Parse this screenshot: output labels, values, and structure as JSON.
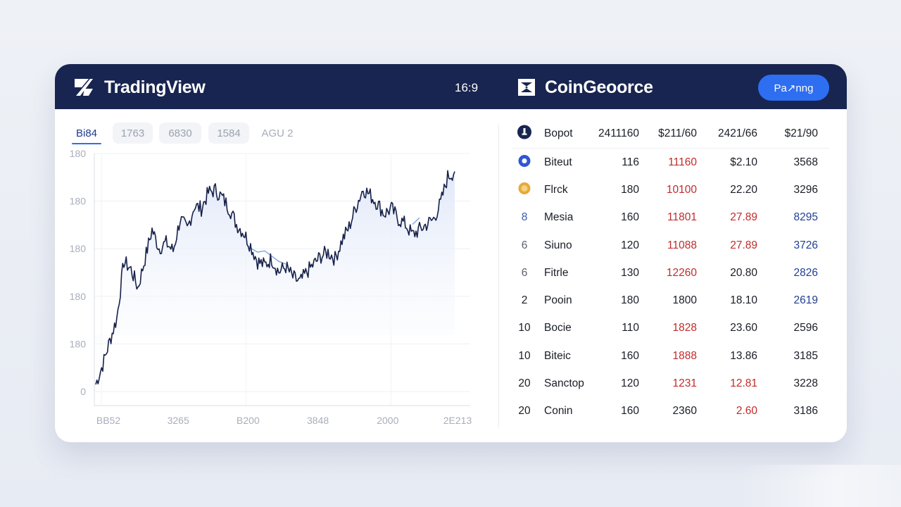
{
  "header": {
    "left_brand": "TradingView",
    "ratio_label": "16:9",
    "right_brand": "CoinGeoorce",
    "cta_label": "Pa↗nng"
  },
  "colors": {
    "navy": "#182550",
    "accent": "#2e6ef0",
    "line": "#16214a",
    "down_red": "#c02b2b",
    "up_blue": "#213e95"
  },
  "icons": {
    "tv_logo": "tradingview-logo-icon",
    "cg_logo": "coin-logo-icon",
    "header_row": "coin-navy-icon",
    "row_1": "coin-blue-icon",
    "row_2": "coin-gold-icon"
  },
  "tabs": [
    {
      "label": "Bi84"
    },
    {
      "label": "1763"
    },
    {
      "label": "6830"
    },
    {
      "label": "1584"
    },
    {
      "label": "AGU 2"
    }
  ],
  "chart_data": {
    "type": "line",
    "y_ticks": [
      "180",
      "180",
      "180",
      "180",
      "180",
      "0"
    ],
    "x_ticks": [
      "BB52",
      "3265",
      "B200",
      "3848",
      "2000",
      "2E213"
    ],
    "ylim": [
      0,
      180
    ],
    "grid": true,
    "legend": "none",
    "x": [
      0,
      10,
      20,
      30,
      40,
      50,
      60,
      70,
      80,
      90,
      100,
      110,
      120,
      130,
      140,
      150,
      160,
      170,
      180,
      190,
      200,
      210,
      220,
      230,
      240,
      250,
      260,
      270,
      280,
      290,
      300,
      310,
      320,
      330,
      340,
      350,
      360,
      370,
      380,
      390,
      400,
      410,
      420,
      430,
      440,
      450,
      460,
      470,
      480,
      490,
      500,
      510
    ],
    "values": [
      15,
      30,
      48,
      65,
      108,
      102,
      88,
      110,
      132,
      118,
      122,
      116,
      140,
      132,
      150,
      148,
      160,
      162,
      156,
      148,
      136,
      130,
      120,
      108,
      105,
      110,
      100,
      104,
      96,
      92,
      100,
      106,
      112,
      115,
      110,
      124,
      134,
      150,
      163,
      158,
      152,
      144,
      148,
      140,
      136,
      128,
      132,
      136,
      140,
      152,
      172,
      176
    ],
    "overlay_values": [
      null,
      null,
      null,
      null,
      null,
      null,
      null,
      null,
      null,
      null,
      null,
      null,
      null,
      null,
      null,
      null,
      null,
      null,
      null,
      null,
      null,
      null,
      118,
      115,
      116,
      112,
      108,
      106,
      null,
      null,
      null,
      null,
      null,
      null,
      null,
      null,
      null,
      null,
      null,
      null,
      null,
      null,
      null,
      null,
      null,
      136,
      141,
      null,
      null,
      null,
      null,
      null
    ]
  },
  "table": {
    "header": {
      "name": "Bopot",
      "a": "2411160",
      "b": "$211/60",
      "c": "2421/66",
      "d": "$21/90"
    },
    "rows": [
      {
        "rank": "",
        "name": "Biteut",
        "a": "116",
        "b": "11160",
        "c": "$2.10",
        "d": "3568",
        "b_color": "red",
        "c_color": "",
        "d_color": ""
      },
      {
        "rank": "",
        "name": "Flrck",
        "a": "180",
        "b": "10100",
        "c": "22.20",
        "d": "3296",
        "b_color": "red",
        "c_color": "",
        "d_color": ""
      },
      {
        "rank": "8",
        "name": "Mesia",
        "a": "160",
        "b": "11801",
        "c": "27.89",
        "d": "8295",
        "b_color": "red",
        "c_color": "red",
        "d_color": "blue",
        "rank_color": "blue"
      },
      {
        "rank": "6",
        "name": "Siuno",
        "a": "120",
        "b": "11088",
        "c": "27.89",
        "d": "3726",
        "b_color": "red",
        "c_color": "red",
        "d_color": "blue",
        "rank_color": "gray"
      },
      {
        "rank": "6",
        "name": "Fitrle",
        "a": "130",
        "b": "12260",
        "c": "20.80",
        "d": "2826",
        "b_color": "red",
        "c_color": "",
        "d_color": "blue",
        "rank_color": "gray"
      },
      {
        "rank": "2",
        "name": "Pooin",
        "a": "180",
        "b": "1800",
        "c": "18.10",
        "d": "2619",
        "b_color": "",
        "c_color": "",
        "d_color": "blue"
      },
      {
        "rank": "10",
        "name": "Bocie",
        "a": "110",
        "b": "1828",
        "c": "23.60",
        "d": "2596",
        "b_color": "red",
        "c_color": "",
        "d_color": ""
      },
      {
        "rank": "10",
        "name": "Biteic",
        "a": "160",
        "b": "1888",
        "c": "13.86",
        "d": "3185",
        "b_color": "red",
        "c_color": "",
        "d_color": ""
      },
      {
        "rank": "20",
        "name": "Sanctop",
        "a": "120",
        "b": "1231",
        "c": "12.81",
        "d": "3228",
        "b_color": "red",
        "c_color": "red",
        "d_color": ""
      },
      {
        "rank": "20",
        "name": "Conin",
        "a": "160",
        "b": "2360",
        "c": "2.60",
        "d": "3186",
        "b_color": "",
        "c_color": "red",
        "d_color": ""
      }
    ]
  }
}
